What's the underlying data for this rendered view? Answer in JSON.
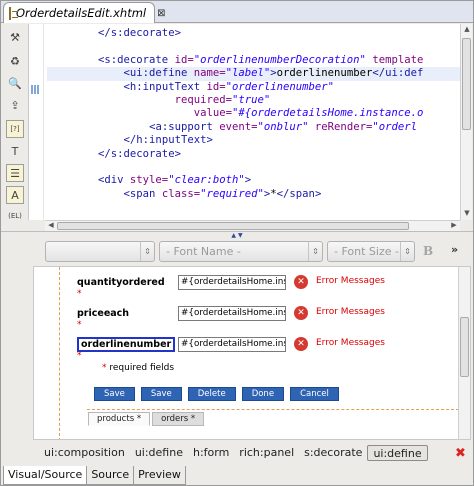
{
  "title_tab": {
    "filename": "OrderdetailsEdit.xhtml",
    "close_glyph": "⊠"
  },
  "vtoolbar": {
    "items": [
      {
        "icon": "tools-icon",
        "glyph": "⚒"
      },
      {
        "icon": "refresh-icon",
        "glyph": "♻"
      },
      {
        "icon": "preview-icon",
        "glyph": "🔍"
      },
      {
        "icon": "export-icon",
        "glyph": "⇪"
      },
      {
        "icon": "frame-icon",
        "glyph": "[?]"
      },
      {
        "icon": "text-icon",
        "glyph": "T"
      },
      {
        "icon": "css-icon",
        "glyph": "☰"
      },
      {
        "icon": "font-icon",
        "glyph": "A"
      },
      {
        "icon": "el-icon",
        "glyph": "(EL)"
      }
    ]
  },
  "code": {
    "lines": [
      {
        "indent": "        ",
        "parts": [
          [
            "tag",
            "</s:decorate>"
          ]
        ]
      },
      {
        "indent": "",
        "parts": []
      },
      {
        "indent": "        ",
        "parts": [
          [
            "tag",
            "<s:decorate "
          ],
          [
            "attr",
            "id="
          ],
          [
            "val",
            "\"orderlinenumberDecoration\""
          ],
          [
            "attr",
            " template"
          ]
        ]
      },
      {
        "indent": "            ",
        "parts": [
          [
            "tag",
            "<ui:define "
          ],
          [
            "attr",
            "name="
          ],
          [
            "val",
            "\"label\""
          ],
          [
            "tag",
            ">"
          ],
          [
            "txt",
            "orderlinenumber"
          ],
          [
            "tag",
            "</ui:def"
          ]
        ],
        "hl": true
      },
      {
        "indent": "            ",
        "parts": [
          [
            "tag",
            "<h:inputText "
          ],
          [
            "attr",
            "id="
          ],
          [
            "val",
            "\"orderlinenumber\""
          ]
        ]
      },
      {
        "indent": "                    ",
        "parts": [
          [
            "attr",
            "required="
          ],
          [
            "val",
            "\"true\""
          ]
        ]
      },
      {
        "indent": "                       ",
        "parts": [
          [
            "attr",
            "value="
          ],
          [
            "val",
            "\"#{orderdetailsHome.instance.o"
          ]
        ]
      },
      {
        "indent": "                ",
        "parts": [
          [
            "tag",
            "<a:support "
          ],
          [
            "attr",
            "event="
          ],
          [
            "val",
            "\"onblur\""
          ],
          [
            "attr",
            " reRender="
          ],
          [
            "val",
            "\"orderl"
          ]
        ]
      },
      {
        "indent": "            ",
        "parts": [
          [
            "tag",
            "</h:inputText>"
          ]
        ]
      },
      {
        "indent": "        ",
        "parts": [
          [
            "tag",
            "</s:decorate>"
          ]
        ]
      },
      {
        "indent": "",
        "parts": []
      },
      {
        "indent": "        ",
        "parts": [
          [
            "tag",
            "<div "
          ],
          [
            "attr",
            "style="
          ],
          [
            "val",
            "\"clear:both\""
          ],
          [
            "tag",
            ">"
          ]
        ]
      },
      {
        "indent": "            ",
        "parts": [
          [
            "tag",
            "<span "
          ],
          [
            "attr",
            "class="
          ],
          [
            "val",
            "\"required\""
          ],
          [
            "tag",
            ">"
          ],
          [
            "txt",
            "*"
          ],
          [
            "tag",
            "</span>"
          ]
        ]
      }
    ]
  },
  "format_toolbar": {
    "combo1": "",
    "font_name": "- Font Name -",
    "font_size": "- Font Size -",
    "bold": "B",
    "more": "»"
  },
  "form": {
    "fields": [
      {
        "label": "quantityordered",
        "value": "#{orderdetailsHome.instan",
        "error": "Error Messages",
        "selected": false
      },
      {
        "label": "priceeach",
        "value": "#{orderdetailsHome.instan",
        "error": "Error Messages",
        "selected": false
      },
      {
        "label": "orderlinenumber",
        "value": "#{orderdetailsHome.instan",
        "error": "Error Messages",
        "selected": true
      }
    ],
    "required_star": "*",
    "required_note": "required fields",
    "buttons": [
      "Save",
      "Save",
      "Delete",
      "Done",
      "Cancel"
    ],
    "sub_tabs": [
      {
        "label": "products *",
        "active": true
      },
      {
        "label": "orders *",
        "active": false
      }
    ]
  },
  "breadcrumbs": {
    "items": [
      "ui:composition",
      "ui:define",
      "h:form",
      "rich:panel",
      "s:decorate",
      "ui:define"
    ],
    "active_index": 5,
    "close_glyph": "✖"
  },
  "bottom_tabs": [
    {
      "label": "Visual/Source",
      "active": true
    },
    {
      "label": "Source",
      "active": false
    },
    {
      "label": "Preview",
      "active": false
    }
  ]
}
